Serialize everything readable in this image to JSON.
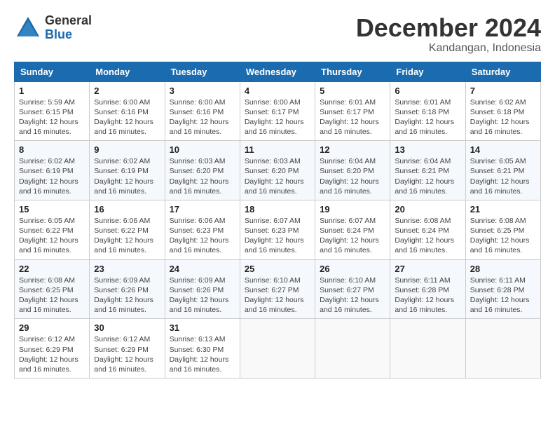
{
  "header": {
    "logo_general": "General",
    "logo_blue": "Blue",
    "month_title": "December 2024",
    "location": "Kandangan, Indonesia"
  },
  "columns": [
    "Sunday",
    "Monday",
    "Tuesday",
    "Wednesday",
    "Thursday",
    "Friday",
    "Saturday"
  ],
  "weeks": [
    [
      {
        "day": "1",
        "sunrise": "Sunrise: 5:59 AM",
        "sunset": "Sunset: 6:15 PM",
        "daylight": "Daylight: 12 hours and 16 minutes."
      },
      {
        "day": "2",
        "sunrise": "Sunrise: 6:00 AM",
        "sunset": "Sunset: 6:16 PM",
        "daylight": "Daylight: 12 hours and 16 minutes."
      },
      {
        "day": "3",
        "sunrise": "Sunrise: 6:00 AM",
        "sunset": "Sunset: 6:16 PM",
        "daylight": "Daylight: 12 hours and 16 minutes."
      },
      {
        "day": "4",
        "sunrise": "Sunrise: 6:00 AM",
        "sunset": "Sunset: 6:17 PM",
        "daylight": "Daylight: 12 hours and 16 minutes."
      },
      {
        "day": "5",
        "sunrise": "Sunrise: 6:01 AM",
        "sunset": "Sunset: 6:17 PM",
        "daylight": "Daylight: 12 hours and 16 minutes."
      },
      {
        "day": "6",
        "sunrise": "Sunrise: 6:01 AM",
        "sunset": "Sunset: 6:18 PM",
        "daylight": "Daylight: 12 hours and 16 minutes."
      },
      {
        "day": "7",
        "sunrise": "Sunrise: 6:02 AM",
        "sunset": "Sunset: 6:18 PM",
        "daylight": "Daylight: 12 hours and 16 minutes."
      }
    ],
    [
      {
        "day": "8",
        "sunrise": "Sunrise: 6:02 AM",
        "sunset": "Sunset: 6:19 PM",
        "daylight": "Daylight: 12 hours and 16 minutes."
      },
      {
        "day": "9",
        "sunrise": "Sunrise: 6:02 AM",
        "sunset": "Sunset: 6:19 PM",
        "daylight": "Daylight: 12 hours and 16 minutes."
      },
      {
        "day": "10",
        "sunrise": "Sunrise: 6:03 AM",
        "sunset": "Sunset: 6:20 PM",
        "daylight": "Daylight: 12 hours and 16 minutes."
      },
      {
        "day": "11",
        "sunrise": "Sunrise: 6:03 AM",
        "sunset": "Sunset: 6:20 PM",
        "daylight": "Daylight: 12 hours and 16 minutes."
      },
      {
        "day": "12",
        "sunrise": "Sunrise: 6:04 AM",
        "sunset": "Sunset: 6:20 PM",
        "daylight": "Daylight: 12 hours and 16 minutes."
      },
      {
        "day": "13",
        "sunrise": "Sunrise: 6:04 AM",
        "sunset": "Sunset: 6:21 PM",
        "daylight": "Daylight: 12 hours and 16 minutes."
      },
      {
        "day": "14",
        "sunrise": "Sunrise: 6:05 AM",
        "sunset": "Sunset: 6:21 PM",
        "daylight": "Daylight: 12 hours and 16 minutes."
      }
    ],
    [
      {
        "day": "15",
        "sunrise": "Sunrise: 6:05 AM",
        "sunset": "Sunset: 6:22 PM",
        "daylight": "Daylight: 12 hours and 16 minutes."
      },
      {
        "day": "16",
        "sunrise": "Sunrise: 6:06 AM",
        "sunset": "Sunset: 6:22 PM",
        "daylight": "Daylight: 12 hours and 16 minutes."
      },
      {
        "day": "17",
        "sunrise": "Sunrise: 6:06 AM",
        "sunset": "Sunset: 6:23 PM",
        "daylight": "Daylight: 12 hours and 16 minutes."
      },
      {
        "day": "18",
        "sunrise": "Sunrise: 6:07 AM",
        "sunset": "Sunset: 6:23 PM",
        "daylight": "Daylight: 12 hours and 16 minutes."
      },
      {
        "day": "19",
        "sunrise": "Sunrise: 6:07 AM",
        "sunset": "Sunset: 6:24 PM",
        "daylight": "Daylight: 12 hours and 16 minutes."
      },
      {
        "day": "20",
        "sunrise": "Sunrise: 6:08 AM",
        "sunset": "Sunset: 6:24 PM",
        "daylight": "Daylight: 12 hours and 16 minutes."
      },
      {
        "day": "21",
        "sunrise": "Sunrise: 6:08 AM",
        "sunset": "Sunset: 6:25 PM",
        "daylight": "Daylight: 12 hours and 16 minutes."
      }
    ],
    [
      {
        "day": "22",
        "sunrise": "Sunrise: 6:08 AM",
        "sunset": "Sunset: 6:25 PM",
        "daylight": "Daylight: 12 hours and 16 minutes."
      },
      {
        "day": "23",
        "sunrise": "Sunrise: 6:09 AM",
        "sunset": "Sunset: 6:26 PM",
        "daylight": "Daylight: 12 hours and 16 minutes."
      },
      {
        "day": "24",
        "sunrise": "Sunrise: 6:09 AM",
        "sunset": "Sunset: 6:26 PM",
        "daylight": "Daylight: 12 hours and 16 minutes."
      },
      {
        "day": "25",
        "sunrise": "Sunrise: 6:10 AM",
        "sunset": "Sunset: 6:27 PM",
        "daylight": "Daylight: 12 hours and 16 minutes."
      },
      {
        "day": "26",
        "sunrise": "Sunrise: 6:10 AM",
        "sunset": "Sunset: 6:27 PM",
        "daylight": "Daylight: 12 hours and 16 minutes."
      },
      {
        "day": "27",
        "sunrise": "Sunrise: 6:11 AM",
        "sunset": "Sunset: 6:28 PM",
        "daylight": "Daylight: 12 hours and 16 minutes."
      },
      {
        "day": "28",
        "sunrise": "Sunrise: 6:11 AM",
        "sunset": "Sunset: 6:28 PM",
        "daylight": "Daylight: 12 hours and 16 minutes."
      }
    ],
    [
      {
        "day": "29",
        "sunrise": "Sunrise: 6:12 AM",
        "sunset": "Sunset: 6:29 PM",
        "daylight": "Daylight: 12 hours and 16 minutes."
      },
      {
        "day": "30",
        "sunrise": "Sunrise: 6:12 AM",
        "sunset": "Sunset: 6:29 PM",
        "daylight": "Daylight: 12 hours and 16 minutes."
      },
      {
        "day": "31",
        "sunrise": "Sunrise: 6:13 AM",
        "sunset": "Sunset: 6:30 PM",
        "daylight": "Daylight: 12 hours and 16 minutes."
      },
      null,
      null,
      null,
      null
    ]
  ]
}
